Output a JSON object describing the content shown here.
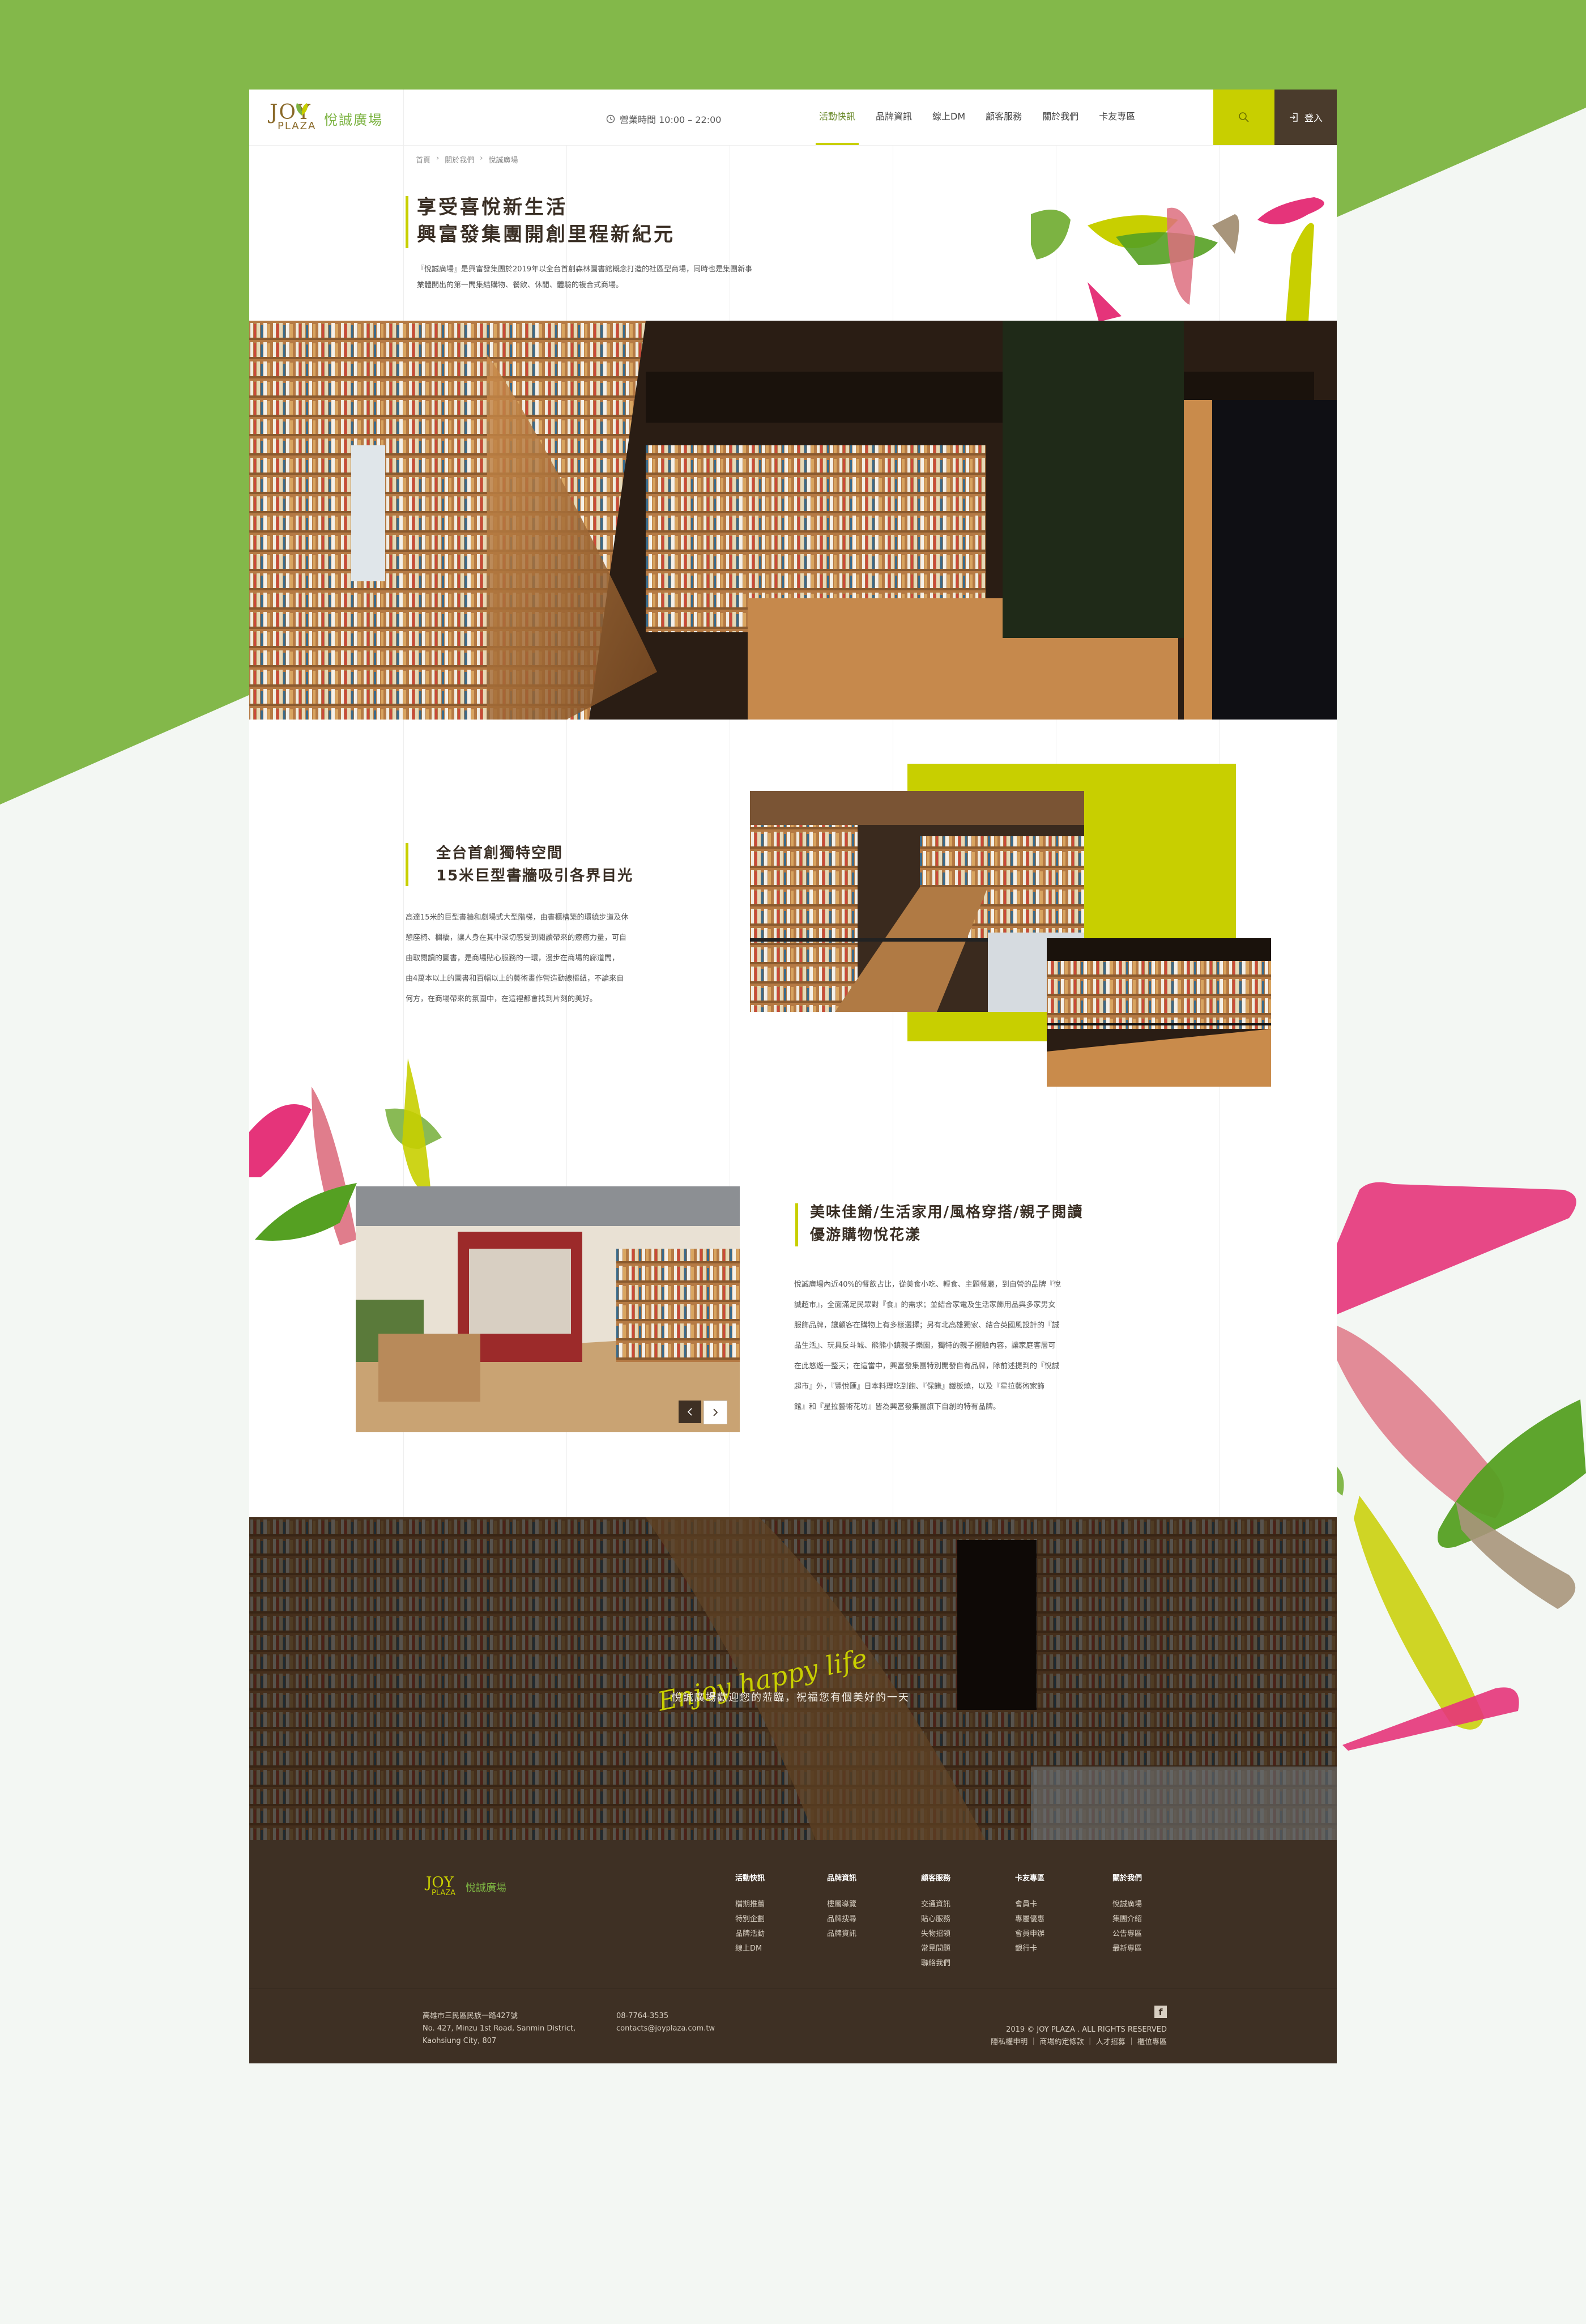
{
  "colors": {
    "green": "#7cb342",
    "lime": "#c8cf00",
    "brown": "#3e3024",
    "pink": "#e5347a"
  },
  "header": {
    "logo_en_top": "JOY",
    "logo_en_bottom": "PLAZA",
    "logo_cn": "悅誠廣場",
    "hours": "營業時間 10:00 – 22:00",
    "nav": [
      "活動快訊",
      "品牌資訊",
      "線上DM",
      "顧客服務",
      "關於我們",
      "卡友專區"
    ],
    "active_nav": "活動快訊",
    "search_icon": "search-icon",
    "login_label": "登入"
  },
  "breadcrumb": [
    "首頁",
    "關於我們",
    "悅誠廣場"
  ],
  "intro": {
    "title_line1": "享受喜悅新生活",
    "title_line2": "興富發集團開創里程新紀元",
    "text_line1": "『悅誠廣場』是興富發集團於2019年以全台首創森林圖書館概念打造的社區型商場，同時也是集團新事",
    "text_line2": "業體開出的第一間集結購物、餐飲、休閒、體驗的複合式商場。"
  },
  "section1": {
    "title_line1": "全台首創獨特空間",
    "title_line2": "15米巨型書牆吸引各界目光",
    "lines": [
      "高達15米的巨型書牆和劇場式大型階梯，由書櫃構築的環繞步道及休",
      "憩座椅、欄橋，讓人身在其中深切感受到閱讀帶來的療癒力量，可自",
      "由取閱讀的圖書，是商場貼心服務的一環，漫步在商場的廊道間，",
      "由4萬本以上的圖書和百幅以上的藝術畫作營造動線樞紐，不論來自",
      "何方，在商場帶來的氛圍中，在這裡都會找到片刻的美好。"
    ]
  },
  "section2": {
    "title_line1": "美味佳餚/生活家用/風格穿搭/親子閱讀",
    "title_line2": "優游購物悅花漾",
    "lines": [
      "悅誠廣場內近40%的餐飲占比，從美食小吃、輕食、主題餐廳，到自營的品牌『悅",
      "誠超市』，全面滿足民眾對『食』的需求；並結合家電及生活家飾用品與多家男女",
      "服飾品牌，讓顧客在購物上有多樣選擇；另有北高雄獨家、結合英國風設計的『誠",
      "品生活』、玩具反斗城、熊熊小鎮親子樂園，獨特的親子體驗內容，讓家庭客層可",
      "在此悠遊一整天；在這當中，興富發集團特別開發自有品牌，除前述提到的『悅誠",
      "超市』外，『豐悅匯』日本料理吃到飽、『保饈』鐵板燒，以及『星拉藝術家飾",
      "館』和『星拉藝術花坊』皆為興富發集團旗下自創的特有品牌。"
    ],
    "prev_icon": "chevron-left-icon",
    "next_icon": "chevron-right-icon"
  },
  "banner": {
    "slogan": "Enjoy happy life",
    "text": "悅誠廣場歡迎您的蒞臨，祝福您有個美好的一天"
  },
  "footer": {
    "logo_en_top": "JOY",
    "logo_en_bottom": "PLAZA",
    "logo_cn": "悅誠廣場",
    "columns": [
      {
        "title": "活動快訊",
        "links": [
          "檔期推薦",
          "特別企劃",
          "品牌活動",
          "線上DM"
        ]
      },
      {
        "title": "品牌資訊",
        "links": [
          "樓層導覽",
          "品牌搜尋",
          "品牌資訊"
        ]
      },
      {
        "title": "顧客服務",
        "links": [
          "交通資訊",
          "貼心服務",
          "失物招領",
          "常見問題",
          "聯絡我們"
        ]
      },
      {
        "title": "卡友專區",
        "links": [
          "會員卡",
          "專屬優惠",
          "會員申辦",
          "銀行卡"
        ]
      },
      {
        "title": "關於我們",
        "links": [
          "悅誠廣場",
          "集團介紹",
          "公告專區",
          "最新專區"
        ]
      }
    ],
    "address_lines": [
      "高雄市三民區民族一路427號",
      "No. 427, Minzu 1st Road, Sanmin District,",
      "Kaohsiung City, 807"
    ],
    "phone": "08-7764-3535",
    "email": "contacts@joyplaza.com.tw",
    "facebook_icon": "facebook-icon",
    "copyright": "2019 © JOY PLAZA . ALL RIGHTS RESERVED",
    "legal_links": "隱私權申明 ｜ 商場約定條款 ｜ 人才招募 ｜ 櫃位專區"
  }
}
